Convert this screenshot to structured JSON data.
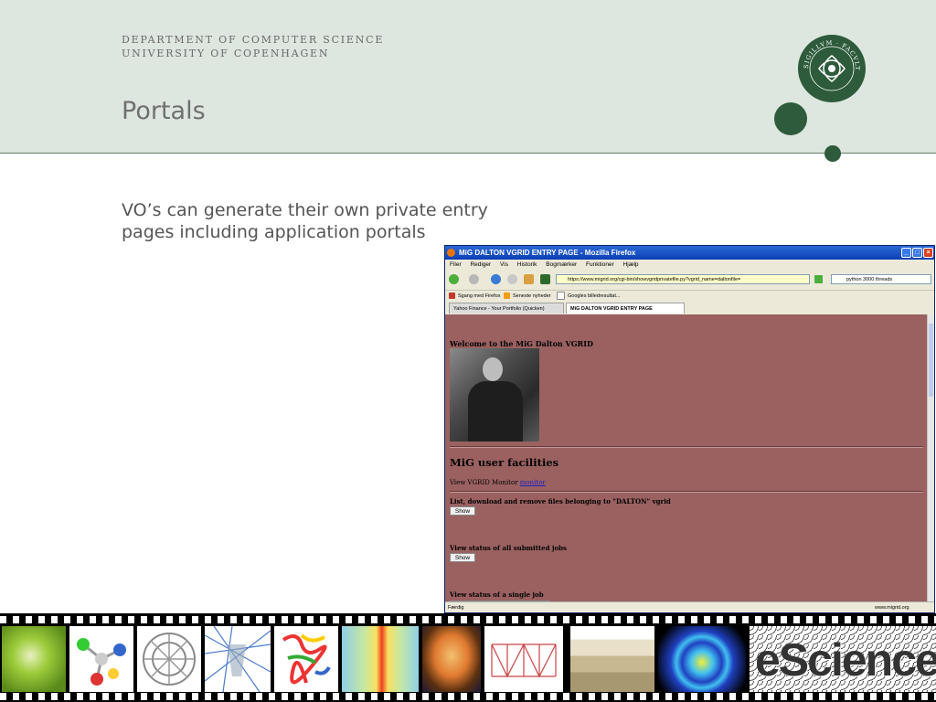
{
  "slide": {
    "department_line1": "DEPARTMENT OF COMPUTER SCIENCE",
    "department_line2": "UNIVERSITY OF COPENHAGEN",
    "title": "Portals",
    "bullet": "VO’s can generate their own private entry pages including application portals",
    "seal_text": "SIGILLVM · FACVLTATIS · NATVRALIS",
    "brand_color": "#2d5b3b",
    "header_bg": "#dde6df"
  },
  "browser": {
    "window_title": "MiG DALTON VGRID ENTRY PAGE - Mozilla Firefox",
    "menu": [
      "Filer",
      "Rediger",
      "Vis",
      "Historik",
      "Bogmærker",
      "Funktioner",
      "Hjælp"
    ],
    "url": "https://www.migrid.org/cgi-bin/showvgridprivatefile.py?vgrid_name=daltonfile=",
    "search_value": "python 3000 threads",
    "bookmarks": [
      "Sgang med Firefox",
      "Seneste nyheder",
      "Googles billedresultat..."
    ],
    "tabs": [
      {
        "label": "Yahoo Finance - Your Portfolio (Quicken)",
        "active": false
      },
      {
        "label": "MiG DALTON VGRID ENTRY PAGE",
        "active": true
      }
    ],
    "status_left": "Færdig",
    "status_right": "www.migrid.org",
    "page": {
      "bg_color": "#9b6161",
      "welcome": "Welcome to the MiG Dalton VGRID",
      "facilities_heading": "MiG user facilities",
      "monitor_text": "View VGRID Monitor ",
      "monitor_link": "monitor",
      "list_files_label": "List, download and remove files belonging to \"DALTON\" vgrid",
      "show_label": "Show",
      "jobs_status_label": "View status of all submitted jobs",
      "single_job_label": "View status of a single job"
    }
  },
  "filmstrip": {
    "frames": [
      "sphere-image",
      "molecule-image",
      "fullerene-image",
      "network-image",
      "protein-image",
      "heatmap-image",
      "brain-scan-image",
      "truss-diagram-image",
      "well-diagram-image",
      "wave-surface-image",
      "escience-logo-image"
    ],
    "logo_text": "eScience"
  }
}
